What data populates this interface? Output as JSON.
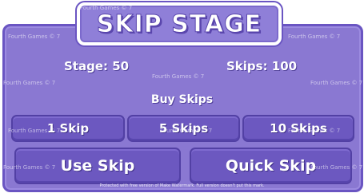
{
  "title": "SKIP STAGE",
  "stats": {
    "stage_label": "Stage: 50",
    "skips_label": "Skips: 100"
  },
  "buy_heading": "Buy Skips",
  "buy_buttons": {
    "one": "1 Skip",
    "five": "5 Skips",
    "ten": "10 Skips"
  },
  "actions": {
    "use": "Use Skip",
    "quick": "Quick Skip"
  },
  "watermark": {
    "text": "Fourth Games © 7",
    "footer": "Protected with free version of Make Watermark. Full version doesn't put this mark."
  },
  "colors": {
    "panel": "#8a78d2",
    "border": "#6a55c2",
    "button": "#6c58c0",
    "text": "#ffffff"
  }
}
